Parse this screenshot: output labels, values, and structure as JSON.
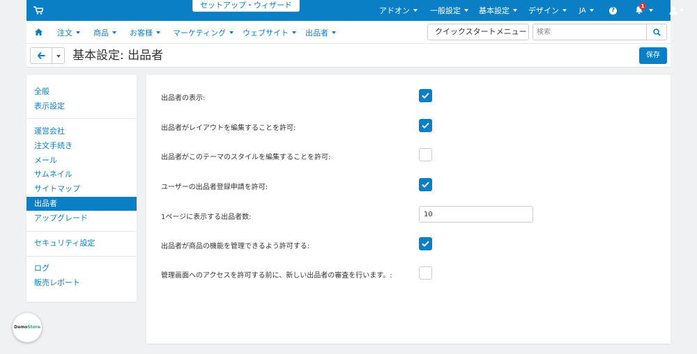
{
  "topbar": {
    "wizard_label": "セットアップ・ウィザード",
    "menus": [
      "アドオン",
      "一般設定",
      "基本設定",
      "デザイン",
      "JA"
    ],
    "notification_count": "1",
    "help_glyph": "?"
  },
  "nav": {
    "items": [
      "注文",
      "商品",
      "お客様",
      "マーケティング",
      "ウェブサイト",
      "出品者"
    ],
    "quick_menu_label": "クイックスタートメニュー",
    "search_placeholder": "検索"
  },
  "title": {
    "text": "基本設定: 出品者",
    "save_label": "保存"
  },
  "sidebar": {
    "items": [
      {
        "label": "全般",
        "active": false
      },
      {
        "label": "表示設定",
        "active": false
      },
      {
        "label": "運営会社",
        "active": false
      },
      {
        "label": "注文手続き",
        "active": false
      },
      {
        "label": "メール",
        "active": false
      },
      {
        "label": "サムネイル",
        "active": false
      },
      {
        "label": "サイトマップ",
        "active": false
      },
      {
        "label": "出品者",
        "active": true
      },
      {
        "label": "アップグレード",
        "active": false
      },
      {
        "label": "セキュリティ設定",
        "active": false
      },
      {
        "label": "ログ",
        "active": false
      },
      {
        "label": "販売レポート",
        "active": false
      }
    ]
  },
  "settings": [
    {
      "label": "出品者の表示:",
      "type": "checkbox",
      "checked": true
    },
    {
      "label": "出品者がレイアウトを編集することを許可:",
      "type": "checkbox",
      "checked": true
    },
    {
      "label": "出品者がこのテーマのスタイルを編集することを許可:",
      "type": "checkbox",
      "checked": false
    },
    {
      "label": "ユーザーの出品者登録申請を許可:",
      "type": "checkbox",
      "checked": true
    },
    {
      "label": "1ページに表示する出品者数:",
      "type": "text",
      "value": "10"
    },
    {
      "label": "出品者が商品の機能を管理できるよう許可する:",
      "type": "checkbox",
      "checked": true
    },
    {
      "label": "管理画面へのアクセスを許可する前に、新しい出品者の審査を行います。:",
      "type": "checkbox",
      "checked": false
    }
  ],
  "demo_badge": {
    "part1": "Demo",
    "part2": "Store"
  },
  "colors": {
    "accent": "#0a7fc6",
    "badge": "#d9363e",
    "store": "#27a17b"
  }
}
